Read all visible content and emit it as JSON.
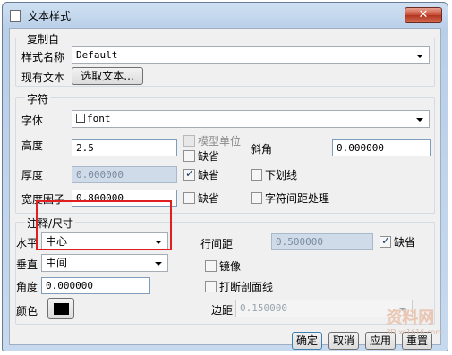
{
  "window": {
    "title": "文本样式",
    "close": "✕"
  },
  "copy_from": {
    "legend": "复制自",
    "style_name_label": "样式名称",
    "style_name_value": "Default",
    "existing_text_label": "现有文本",
    "select_text_button": "选取文本..."
  },
  "character": {
    "legend": "字符",
    "font_label": "字体",
    "font_value": "font",
    "height_label": "高度",
    "height_value": "2.5",
    "model_units_label": "模型单位",
    "default_label": "缺省",
    "slant_label": "斜角",
    "slant_value": "0.000000",
    "thickness_label": "厚度",
    "thickness_value": "0.000000",
    "underline_label": "下划线",
    "width_factor_label": "宽度因子",
    "width_factor_value": "0.800000",
    "kerning_label": "字符间距处理"
  },
  "note": {
    "legend": "注释/尺寸",
    "horizontal_label": "水平",
    "horizontal_value": "中心",
    "vertical_label": "垂直",
    "vertical_value": "中间",
    "angle_label": "角度",
    "angle_value": "0.000000",
    "color_label": "颜色",
    "color_value": "#000000",
    "line_spacing_label": "行间距",
    "line_spacing_value": "0.500000",
    "default_label": "缺省",
    "mirror_label": "镜像",
    "break_hatch_label": "打断剖面线",
    "margin_label": "边距",
    "margin_value": "0.150000"
  },
  "footer": {
    "ok": "确定",
    "cancel": "取消",
    "apply": "应用",
    "reset": "重置"
  },
  "watermark": {
    "text": "资料网",
    "sub": "3D.xs1616.com"
  }
}
